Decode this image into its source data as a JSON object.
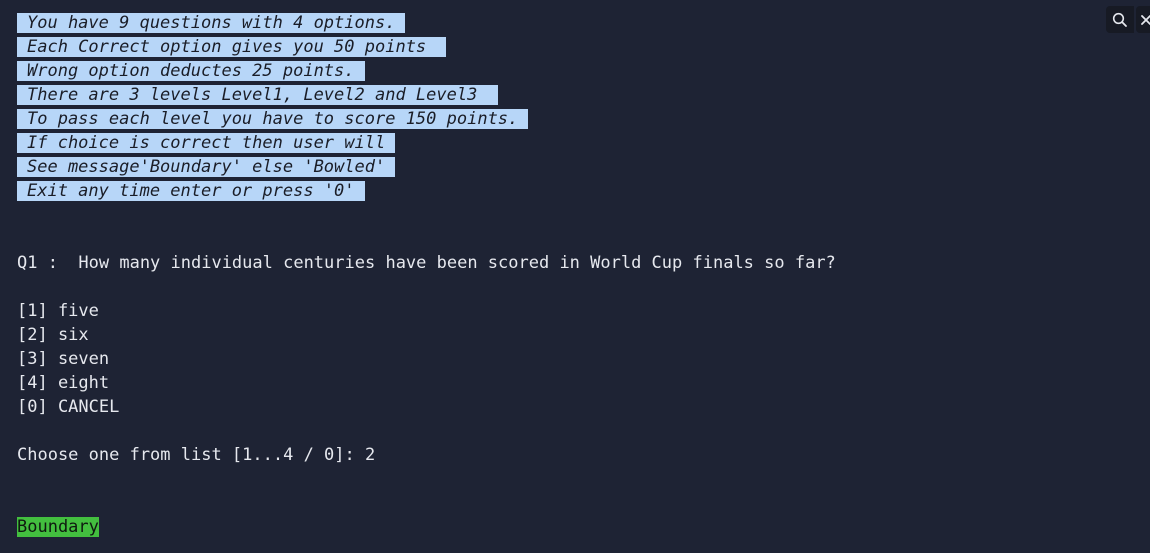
{
  "intro_lines": [
    "You have 9 questions with 4 options.",
    "Each Correct option gives you 50 points ",
    "Wrong option deductes 25 points.",
    "There are 3 levels Level1, Level2 and Level3 ",
    "To pass each level you have to score 150 points.",
    "If choice is correct then user will",
    "See message'Boundary' else 'Bowled'",
    "Exit any time enter or press '0'"
  ],
  "question": "Q1 :  How many individual centuries have been scored in World Cup finals so far?",
  "options": [
    "[1] five",
    "[2] six",
    "[3] seven",
    "[4] eight",
    "[0] CANCEL"
  ],
  "prompt": "Choose one from list [1...4 / 0]: 2",
  "result": "Boundary",
  "toolbar": {
    "search_icon": "search-icon",
    "close_icon": "close-icon"
  },
  "colors": {
    "background": "#1e2334",
    "selection": "#b7d6f8",
    "result_highlight": "#43bf3f"
  }
}
